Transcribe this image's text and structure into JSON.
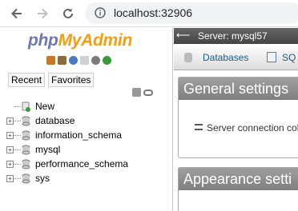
{
  "browser": {
    "url": "localhost:32906"
  },
  "nav": {
    "logo_php": "php",
    "logo_myadmin": "MyAdmin",
    "tabs": [
      "Recent",
      "Favorites"
    ],
    "tree": [
      {
        "label": "New",
        "kind": "new"
      },
      {
        "label": "database",
        "kind": "db"
      },
      {
        "label": "information_schema",
        "kind": "db"
      },
      {
        "label": "mysql",
        "kind": "db"
      },
      {
        "label": "performance_schema",
        "kind": "db"
      },
      {
        "label": "sys",
        "kind": "db"
      }
    ]
  },
  "content": {
    "server_label": "Server: mysql57",
    "menu": [
      "Databases",
      "SQ"
    ],
    "panel1_title": "General settings",
    "panel1_item": "Server connection coll",
    "panel2_title": "Appearance setti"
  }
}
